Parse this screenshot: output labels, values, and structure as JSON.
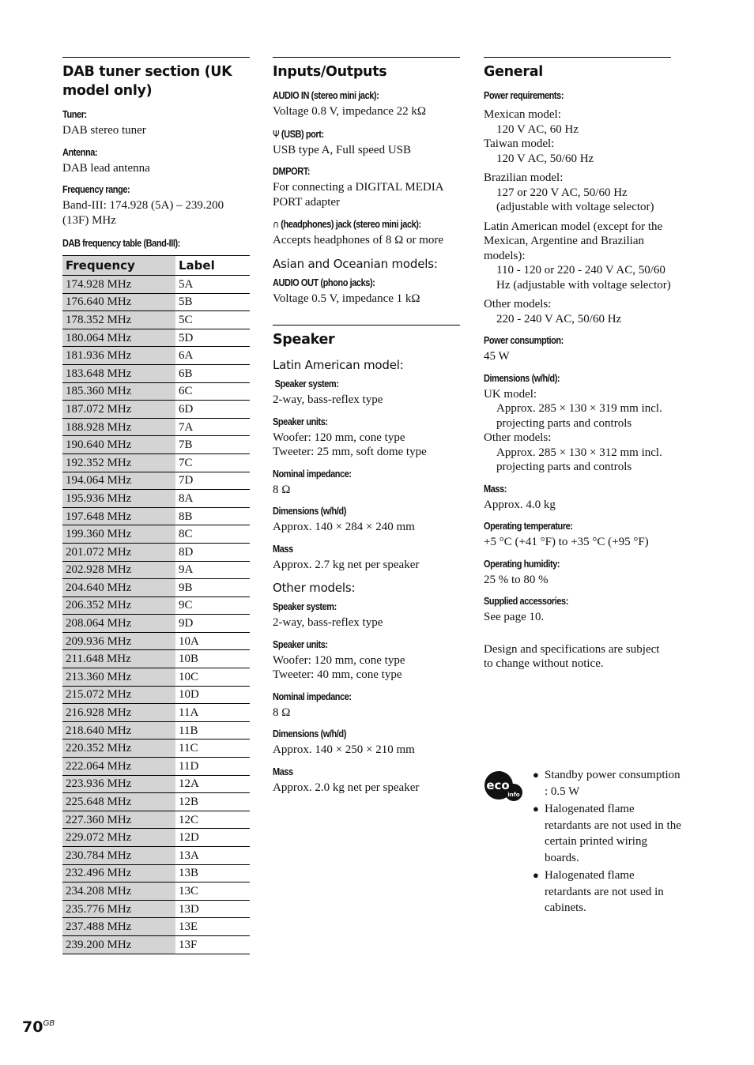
{
  "page": {
    "number": "70",
    "suffix": "GB"
  },
  "dab": {
    "title": "DAB tuner section (UK model only)",
    "specs": [
      {
        "label": "Tuner:",
        "value": "DAB stereo tuner"
      },
      {
        "label": "Antenna:",
        "value": "DAB lead antenna"
      },
      {
        "label": "Frequency range:",
        "value": "Band-III: 174.928 (5A) – 239.200 (13F) MHz"
      }
    ],
    "table_label": "DAB frequency table (Band-III):",
    "table": {
      "headers": [
        "Frequency",
        "Label"
      ],
      "rows": [
        [
          "174.928 MHz",
          "5A"
        ],
        [
          "176.640 MHz",
          "5B"
        ],
        [
          "178.352 MHz",
          "5C"
        ],
        [
          "180.064 MHz",
          "5D"
        ],
        [
          "181.936 MHz",
          "6A"
        ],
        [
          "183.648 MHz",
          "6B"
        ],
        [
          "185.360 MHz",
          "6C"
        ],
        [
          "187.072 MHz",
          "6D"
        ],
        [
          "188.928 MHz",
          "7A"
        ],
        [
          "190.640 MHz",
          "7B"
        ],
        [
          "192.352 MHz",
          "7C"
        ],
        [
          "194.064 MHz",
          "7D"
        ],
        [
          "195.936 MHz",
          "8A"
        ],
        [
          "197.648 MHz",
          "8B"
        ],
        [
          "199.360 MHz",
          "8C"
        ],
        [
          "201.072 MHz",
          "8D"
        ],
        [
          "202.928 MHz",
          "9A"
        ],
        [
          "204.640 MHz",
          "9B"
        ],
        [
          "206.352 MHz",
          "9C"
        ],
        [
          "208.064 MHz",
          "9D"
        ],
        [
          "209.936 MHz",
          "10A"
        ],
        [
          "211.648 MHz",
          "10B"
        ],
        [
          "213.360 MHz",
          "10C"
        ],
        [
          "215.072 MHz",
          "10D"
        ],
        [
          "216.928 MHz",
          "11A"
        ],
        [
          "218.640 MHz",
          "11B"
        ],
        [
          "220.352 MHz",
          "11C"
        ],
        [
          "222.064 MHz",
          "11D"
        ],
        [
          "223.936 MHz",
          "12A"
        ],
        [
          "225.648 MHz",
          "12B"
        ],
        [
          "227.360 MHz",
          "12C"
        ],
        [
          "229.072 MHz",
          "12D"
        ],
        [
          "230.784 MHz",
          "13A"
        ],
        [
          "232.496 MHz",
          "13B"
        ],
        [
          "234.208 MHz",
          "13C"
        ],
        [
          "235.776 MHz",
          "13D"
        ],
        [
          "237.488 MHz",
          "13E"
        ],
        [
          "239.200 MHz",
          "13F"
        ]
      ]
    }
  },
  "io": {
    "title": "Inputs/Outputs",
    "audio_in": {
      "label": "AUDIO IN (stereo mini jack):",
      "value": "Voltage 0.8 V, impedance 22 kΩ"
    },
    "usb": {
      "icon": "usb-icon",
      "label": "(USB) port:",
      "value": "USB type A, Full speed USB"
    },
    "dmport": {
      "label": "DMPORT:",
      "value": "For connecting a DIGITAL MEDIA PORT adapter"
    },
    "headphones": {
      "icon": "headphones-icon",
      "label": "(headphones) jack (stereo mini jack):",
      "value": "Accepts headphones of 8 Ω or more"
    },
    "asian_heading": "Asian and Oceanian models:",
    "audio_out": {
      "label": "AUDIO OUT (phono jacks):",
      "value": "Voltage 0.5 V, impedance 1 kΩ"
    }
  },
  "speaker": {
    "title": "Speaker",
    "latin": {
      "heading": "Latin American model:",
      "system": {
        "label": "Speaker system:",
        "value": "2-way, bass-reflex type"
      },
      "units": {
        "label": "Speaker units:",
        "lines": [
          "Woofer: 120 mm, cone type",
          "Tweeter: 25 mm, soft dome type"
        ]
      },
      "impedance": {
        "label": "Nominal impedance:",
        "value": "8 Ω"
      },
      "dimensions": {
        "label": "Dimensions (w/h/d)",
        "value": "Approx. 140 × 284 × 240 mm"
      },
      "mass": {
        "label": "Mass",
        "value": "Approx. 2.7 kg net per speaker"
      }
    },
    "other": {
      "heading": "Other models:",
      "system": {
        "label": "Speaker system:",
        "value": "2-way, bass-reflex type"
      },
      "units": {
        "label": "Speaker units:",
        "lines": [
          "Woofer: 120 mm, cone type",
          "Tweeter: 40 mm, cone type"
        ]
      },
      "impedance": {
        "label": "Nominal impedance:",
        "value": "8 Ω"
      },
      "dimensions": {
        "label": "Dimensions (w/h/d)",
        "value": "Approx. 140 × 250 × 210 mm"
      },
      "mass": {
        "label": "Mass",
        "value": "Approx. 2.0 kg net per speaker"
      }
    }
  },
  "general": {
    "title": "General",
    "power_req": {
      "label": "Power requirements:",
      "groups": [
        {
          "lines": [
            {
              "text": "Mexican model:",
              "indent": false
            },
            {
              "text": "120 V AC, 60 Hz",
              "indent": true
            },
            {
              "text": "Taiwan model:",
              "indent": false
            },
            {
              "text": "120 V AC, 50/60 Hz",
              "indent": true
            }
          ]
        },
        {
          "lines": [
            {
              "text": "Brazilian model:",
              "indent": false
            },
            {
              "text": "127 or 220 V AC, 50/60 Hz",
              "indent": true
            },
            {
              "text": "(adjustable with voltage selector)",
              "indent": true
            }
          ]
        },
        {
          "lines": [
            {
              "text": "Latin American model (except for the Mexican, Argentine and Brazilian models):",
              "indent": false
            },
            {
              "text": "110 - 120 or 220 - 240 V AC, 50/60 Hz (adjustable with voltage selector)",
              "indent": true
            }
          ]
        },
        {
          "lines": [
            {
              "text": "Other models:",
              "indent": false
            },
            {
              "text": "220 - 240 V AC, 50/60 Hz",
              "indent": true
            }
          ]
        }
      ]
    },
    "power_consumption": {
      "label": "Power consumption:",
      "value": "45 W"
    },
    "dimensions": {
      "label": "Dimensions (w/h/d):",
      "lines": [
        {
          "text": "UK model:",
          "indent": false
        },
        {
          "text": "Approx. 285 × 130 × 319 mm incl. projecting parts and controls",
          "indent": true
        },
        {
          "text": "Other models:",
          "indent": false
        },
        {
          "text": "Approx. 285 × 130 × 312 mm incl. projecting parts and controls",
          "indent": true
        }
      ]
    },
    "mass": {
      "label": "Mass:",
      "value": "Approx. 4.0 kg"
    },
    "op_temp": {
      "label": "Operating temperature:",
      "value": "+5 °C (+41 °F) to +35 °C (+95 °F)"
    },
    "op_humidity": {
      "label": "Operating humidity:",
      "value": "25 % to 80 %"
    },
    "accessories": {
      "label": "Supplied accessories:",
      "value": "See page 10."
    },
    "notice": "Design and specifications are subject to change without notice."
  },
  "eco": {
    "logo_main": "eco",
    "logo_sub": "info",
    "items": [
      "Standby power consumption : 0.5 W",
      "Halogenated flame retardants are not used in the certain printed wiring boards.",
      "Halogenated flame retardants are not used in cabinets."
    ]
  }
}
